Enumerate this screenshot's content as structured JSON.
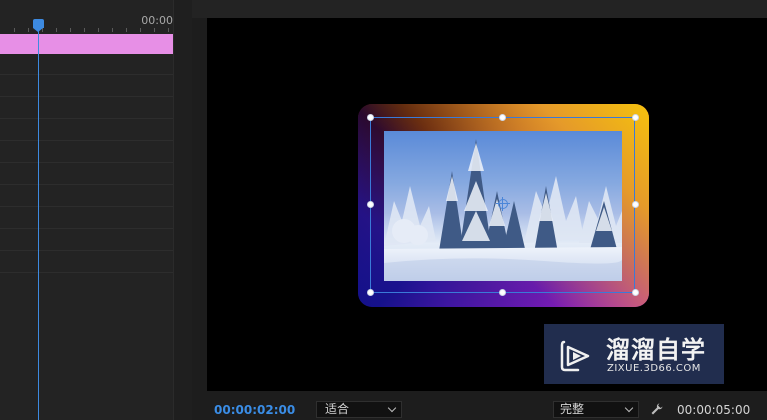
{
  "timeline": {
    "ruler_time": "00:00",
    "clip_color": "#e78fe6",
    "playhead_color": "#3d8ae0"
  },
  "monitor": {
    "current_time": "00:00:02:00",
    "fit_option": "适合",
    "quality_option": "完整",
    "duration": "00:00:05:00",
    "settings_icon": "wrench-icon"
  },
  "watermark": {
    "title": "溜溜自学",
    "url": "ZIXUE.3D66.COM",
    "logo_icon": "play-logo-icon"
  }
}
